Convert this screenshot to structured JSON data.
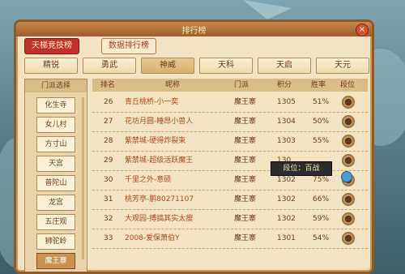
{
  "window": {
    "title": "排行榜",
    "close_icon": "×"
  },
  "top_tabs": [
    {
      "label": "天梯竞技榜",
      "active": true
    },
    {
      "label": "数据排行榜",
      "active": false
    }
  ],
  "sects": [
    {
      "label": "精锐",
      "selected": false
    },
    {
      "label": "勇武",
      "selected": false
    },
    {
      "label": "神威",
      "selected": true
    },
    {
      "label": "天科",
      "selected": false
    },
    {
      "label": "天启",
      "selected": false
    },
    {
      "label": "天元",
      "selected": false
    }
  ],
  "sidebar": {
    "header": "门派选择",
    "items": [
      {
        "label": "化生寺",
        "selected": false
      },
      {
        "label": "女儿村",
        "selected": false
      },
      {
        "label": "方寸山",
        "selected": false
      },
      {
        "label": "天宫",
        "selected": false
      },
      {
        "label": "普陀山",
        "selected": false
      },
      {
        "label": "龙宫",
        "selected": false
      },
      {
        "label": "五庄观",
        "selected": false
      },
      {
        "label": "狮驼岭",
        "selected": false
      },
      {
        "label": "魔王寨",
        "selected": true
      }
    ]
  },
  "table": {
    "headers": [
      "排名",
      "昵称",
      "门派",
      "积分",
      "胜率",
      "段位"
    ],
    "rows": [
      {
        "rank": "26",
        "name": "青丘桃桥-小一奕",
        "school": "魔王寨",
        "score": "1305",
        "winrate": "51%"
      },
      {
        "rank": "27",
        "name": "花坊月圆-睡昂小兽人",
        "school": "魔王寨",
        "score": "1304",
        "winrate": "50%"
      },
      {
        "rank": "28",
        "name": "紫禁城-硬得炸裂束",
        "school": "魔王寨",
        "score": "1303",
        "winrate": "55%"
      },
      {
        "rank": "29",
        "name": "紫禁城-超级活跃魔王",
        "school": "魔王寨",
        "score": "130",
        "winrate": ""
      },
      {
        "rank": "30",
        "name": "千里之外-意硕",
        "school": "魔王寨",
        "score": "1302",
        "winrate": "75%"
      },
      {
        "rank": "31",
        "name": "桃芳亭-鹏80271107",
        "school": "魔王寨",
        "score": "1302",
        "winrate": "66%"
      },
      {
        "rank": "32",
        "name": "大观园-搏搞其实太瘦",
        "school": "魔王寨",
        "score": "1302",
        "winrate": "59%"
      },
      {
        "rank": "33",
        "name": "2008-爱保萧伯Y",
        "school": "魔王寨",
        "score": "1301",
        "winrate": "54%"
      }
    ]
  },
  "tooltip": {
    "text": "段位：百战"
  },
  "colors": {
    "accent": "#c0322a",
    "panel": "#f2e4c2",
    "border": "#8e5a2a"
  },
  "icons": {
    "rank_badge": "rank-badge-icon",
    "pin": "map-pin-icon"
  }
}
